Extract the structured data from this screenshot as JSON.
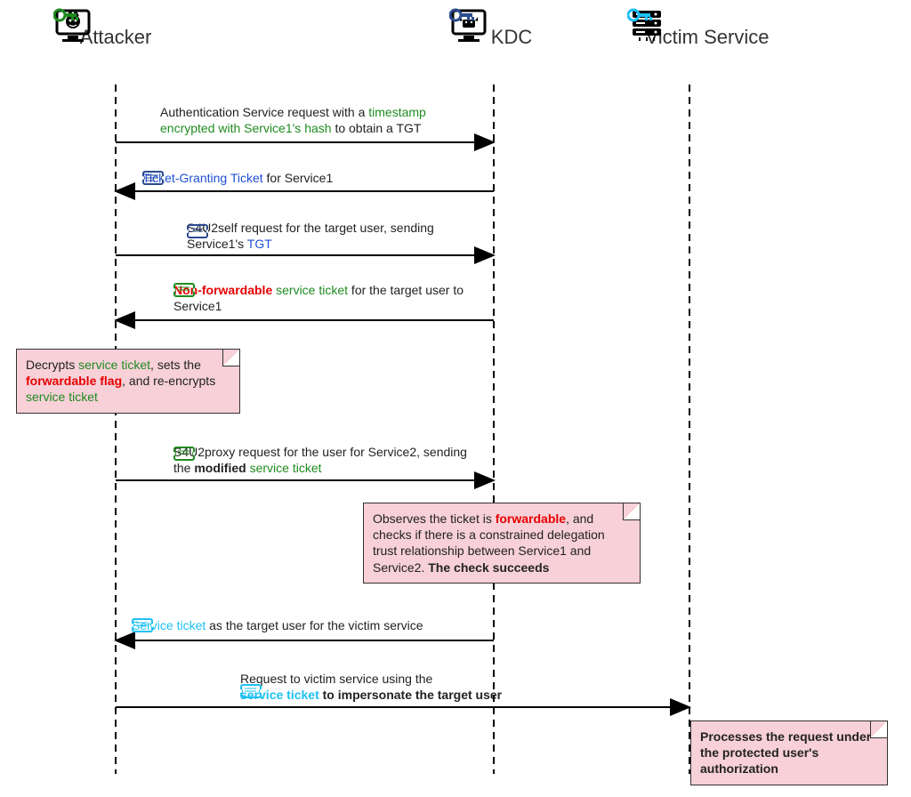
{
  "participants": {
    "attacker": "Attacker",
    "kdc": "KDC",
    "victim": "Victim Service"
  },
  "messages": {
    "m1_a": "Authentication Service request with a ",
    "m1_b": "timestamp encrypted with Service1's hash",
    "m1_c": " to obtain a TGT",
    "m2_a": "Ticket-Granting Ticket",
    "m2_b": " for Service1",
    "m3_a": "S4U2self request for the target user, sending Service1's ",
    "m3_b": "TGT",
    "m4_a": "Non-forwardable",
    "m4_b": " service ticket",
    "m4_c": " for the target user to Service1",
    "m5_a": "S4U2proxy request for the user for Service2, sending the ",
    "m5_b": "modified",
    "m5_c": " service ticket",
    "m6_a": "Service ticket",
    "m6_b": " as the target user for the victim service",
    "m7_a": "Request to victim service using the ",
    "m7_b": "service ticket",
    "m7_c": " to impersonate the target user"
  },
  "notes": {
    "n1_a": "Decrypts ",
    "n1_b": "service ticket",
    "n1_c": ", sets the ",
    "n1_d": "forwardable flag",
    "n1_e": ", and re-encrypts ",
    "n1_f": "service ticket",
    "n2_a": "Observes the ticket is ",
    "n2_b": "forwardable",
    "n2_c": ", and checks if there is a constrained delegation trust relationship between Service1 and Service2. ",
    "n2_d": "The check succeeds",
    "n3_a": "Processes the request under the protected user's authorization"
  },
  "colors": {
    "green": "#1f8b1f",
    "red": "#e60000",
    "blue": "#1f4fd6",
    "cyan": "#1ec0f2",
    "note_bg": "#f7d0d8"
  },
  "chart_data": {
    "type": "sequence-diagram",
    "participants": [
      "Attacker",
      "KDC",
      "Victim Service"
    ],
    "steps": [
      {
        "from": "Attacker",
        "to": "KDC",
        "text": "Authentication Service request with a timestamp encrypted with Service1's hash to obtain a TGT"
      },
      {
        "from": "KDC",
        "to": "Attacker",
        "text": "Ticket-Granting Ticket for Service1"
      },
      {
        "from": "Attacker",
        "to": "KDC",
        "text": "S4U2self request for the target user, sending Service1's TGT"
      },
      {
        "from": "KDC",
        "to": "Attacker",
        "text": "Non-forwardable service ticket for the target user to Service1"
      },
      {
        "note_over": "Attacker",
        "text": "Decrypts service ticket, sets the forwardable flag, and re-encrypts service ticket"
      },
      {
        "from": "Attacker",
        "to": "KDC",
        "text": "S4U2proxy request for the user for Service2, sending the modified service ticket"
      },
      {
        "note_over": "KDC",
        "text": "Observes the ticket is forwardable, and checks if there is a constrained delegation trust relationship between Service1 and Service2. The check succeeds"
      },
      {
        "from": "KDC",
        "to": "Attacker",
        "text": "Service ticket as the target user for the victim service"
      },
      {
        "from": "Attacker",
        "to": "Victim Service",
        "text": "Request to victim service using the service ticket to impersonate the target user"
      },
      {
        "note_over": "Victim Service",
        "text": "Processes the request under the protected user's authorization"
      }
    ]
  }
}
